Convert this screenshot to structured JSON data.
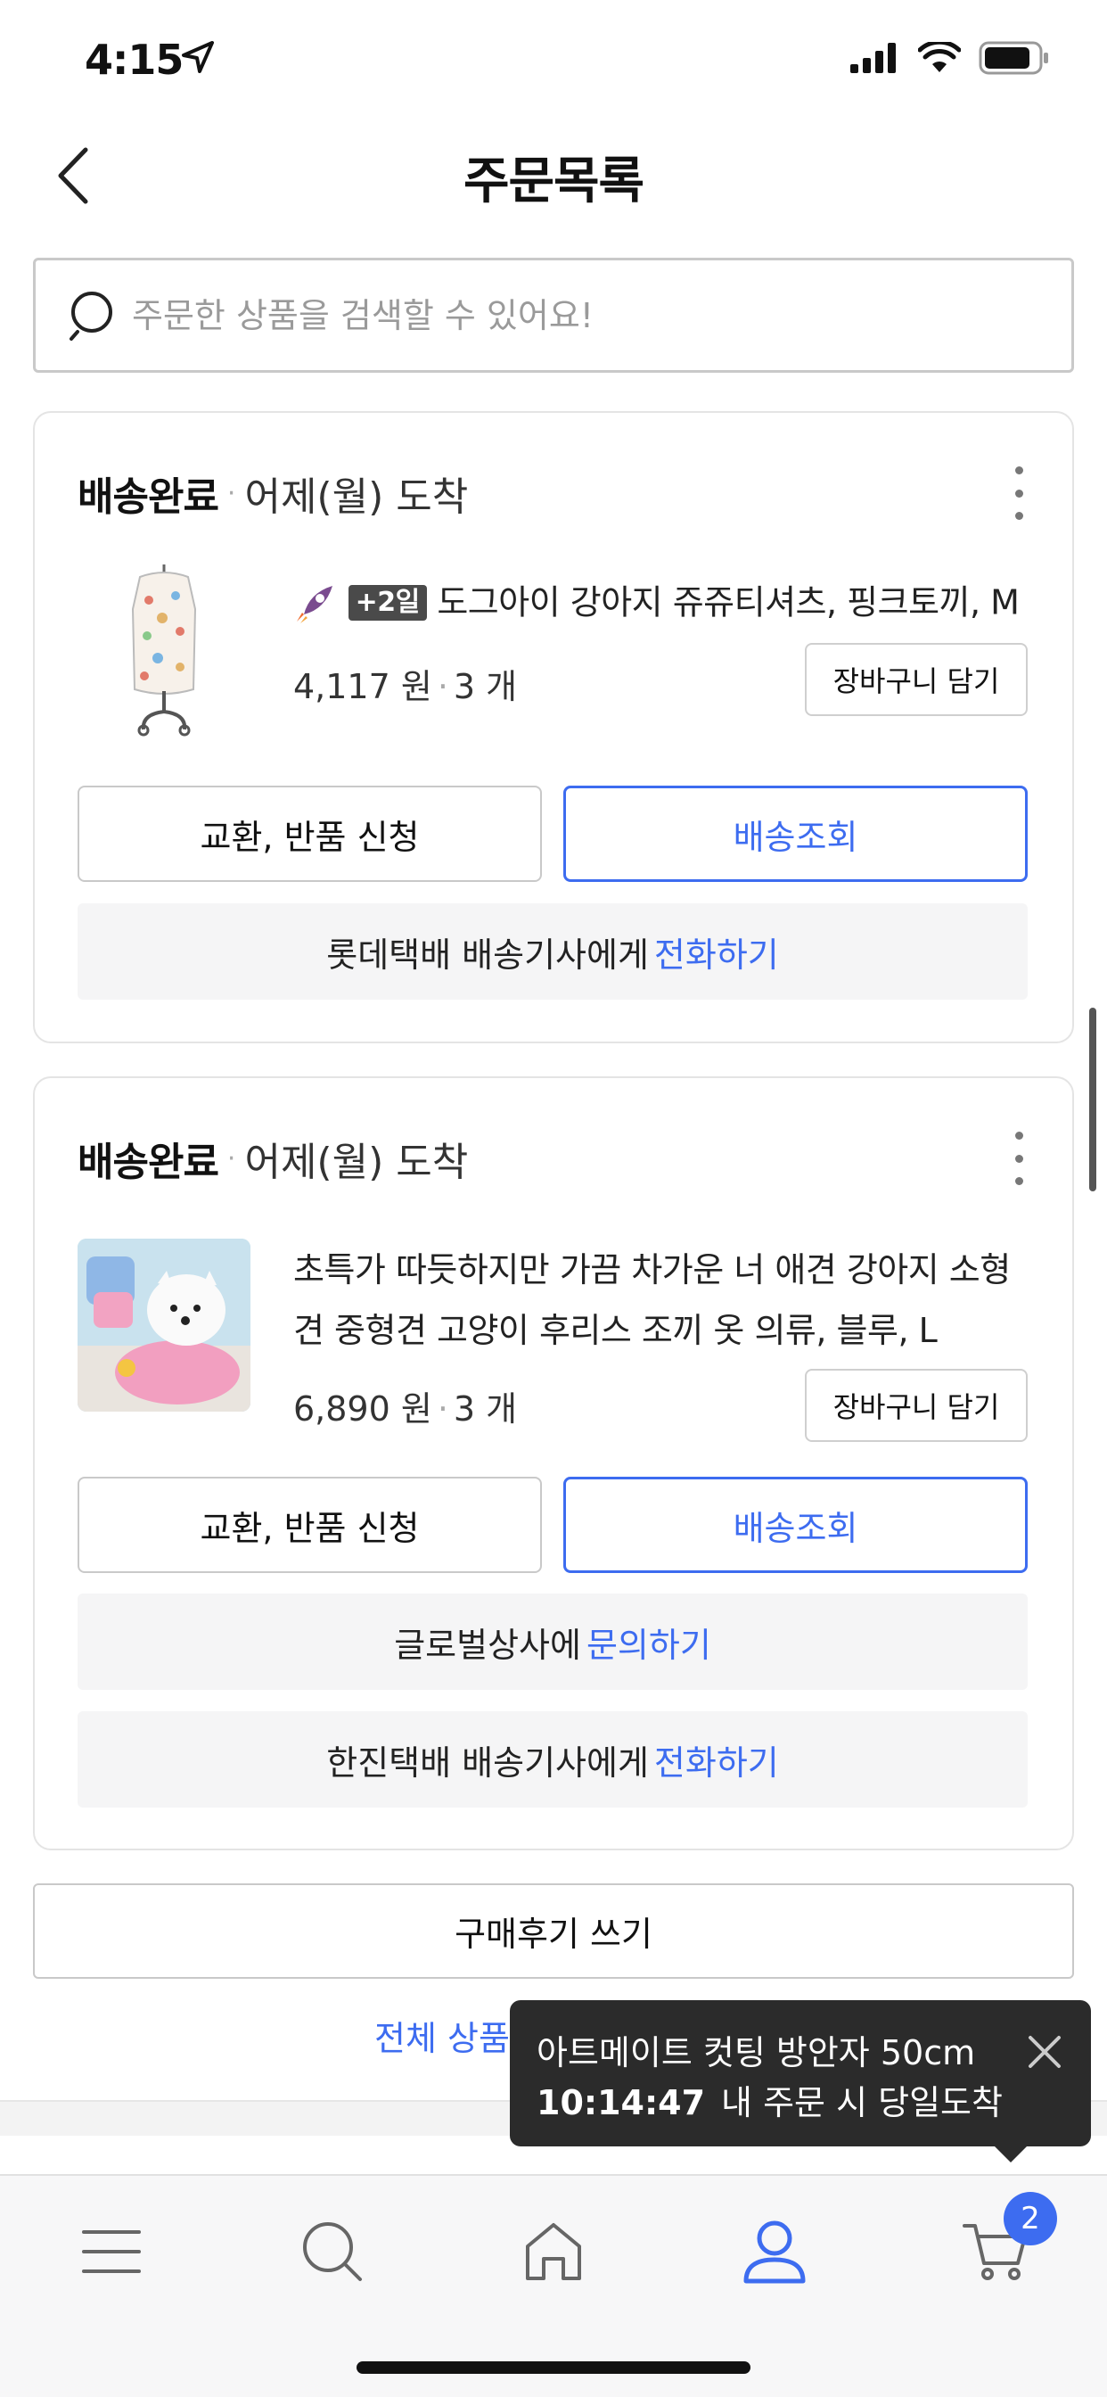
{
  "status_bar": {
    "time": "4:15"
  },
  "nav": {
    "title": "주문목록"
  },
  "search": {
    "placeholder": "주문한 상품을 검색할 수 있어요!"
  },
  "orders": [
    {
      "status": "배송완료",
      "arrival": "어제(월) 도착",
      "badge": "+2일",
      "product_name": "도그아이 강아지 쥬쥬티셔츠, 핑크토끼, M",
      "price": "4,117 원",
      "quantity": "3 개",
      "cart_label": "장바구니 담기",
      "exchange_label": "교환, 반품 신청",
      "track_label": "배송조회",
      "info_rows": [
        {
          "text": "롯데택배  배송기사에게",
          "link": "전화하기"
        }
      ]
    },
    {
      "status": "배송완료",
      "arrival": "어제(월) 도착",
      "product_name": "초특가 따듯하지만 가끔 차가운 너 애견 강아지 소형견 중형견 고양이 후리스 조끼 옷 의류, 블루, L",
      "price": "6,890 원",
      "quantity": "3 개",
      "cart_label": "장바구니 담기",
      "exchange_label": "교환, 반품 신청",
      "track_label": "배송조회",
      "info_rows": [
        {
          "text": "글로벌상사에",
          "link": "문의하기"
        },
        {
          "text": "한진택배  배송기사에게",
          "link": "전화하기"
        }
      ]
    }
  ],
  "review_button": "구매후기 쓰기",
  "all_products_link": "전체 상품",
  "toast": {
    "line1": "아트메이트 컷팅 방안자 50cm",
    "countdown": "10:14:47",
    "line2_rest": "내 주문 시 당일도착"
  },
  "tab_bar": {
    "items": [
      "menu-icon",
      "search-icon",
      "home-icon",
      "user-icon",
      "cart-icon"
    ],
    "cart_count": "2",
    "active_color": "#3d6cf0"
  }
}
